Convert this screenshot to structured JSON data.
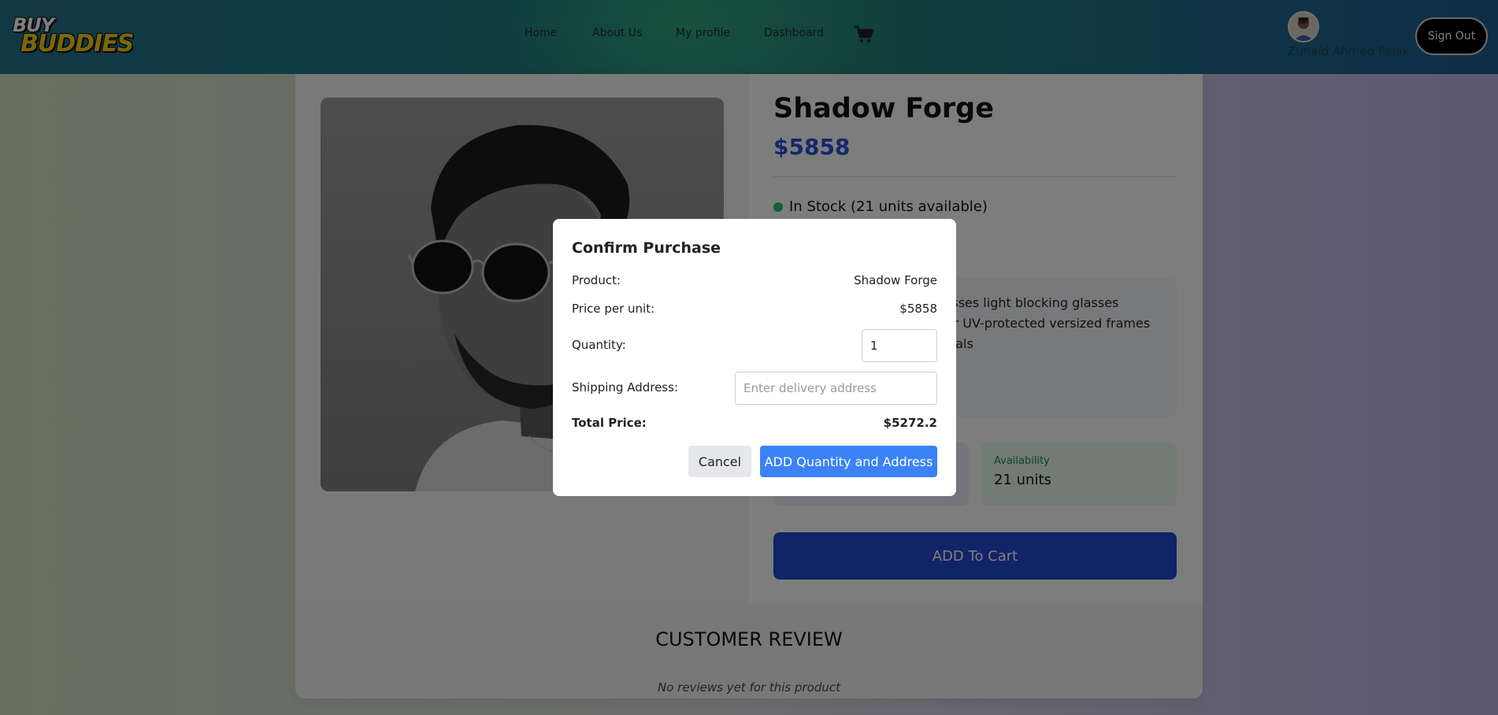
{
  "nav": {
    "logo_top": "BUY",
    "logo_bottom": "BUDDIES",
    "links": [
      "Home",
      "About Us",
      "My profile",
      "Dashboard"
    ],
    "cart_icon": "shopping-cart-icon",
    "user_name": "Zunaid Ahmed Palak",
    "signout_label": "Sign Out"
  },
  "product": {
    "title": "Shadow Forge",
    "price": "$5858",
    "stock_text": "In Stock (21 units available)",
    "description_visible": "sunglasses Sports sunglasses light blocking glasses Materials: nes Polarized or UV-protected versized frames Aviators Round dly materials",
    "availability_label": "Availability",
    "availability_value": "21 units",
    "add_to_cart_label": "ADD To Cart"
  },
  "reviews": {
    "title": "CUSTOMER REVIEW",
    "empty_text": "No reviews yet for this product"
  },
  "modal": {
    "title": "Confirm Purchase",
    "product_label": "Product:",
    "product_value": "Shadow Forge",
    "price_label": "Price per unit:",
    "price_value": "$5858",
    "quantity_label": "Quantity:",
    "quantity_value": "1",
    "address_label": "Shipping Address:",
    "address_placeholder": "Enter delivery address",
    "total_label": "Total Price:",
    "total_value": "$5272.2",
    "cancel_label": "Cancel",
    "confirm_label": "ADD Quantity and Address"
  },
  "colors": {
    "accent_blue": "#2b4ed6",
    "button_blue": "#3b82f6",
    "cart_button": "#2348d0",
    "stock_green": "#22c55e"
  }
}
